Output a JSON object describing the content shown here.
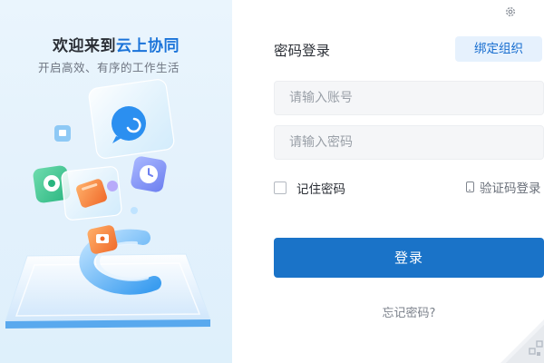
{
  "left": {
    "welcome_prefix": "欢迎来到",
    "brand": "云上协同",
    "subtitle": "开启高效、有序的工作生活"
  },
  "login": {
    "title": "密码登录",
    "bind_org": "绑定组织",
    "account_placeholder": "请输入账号",
    "password_placeholder": "请输入密码",
    "remember_label": "记住密码",
    "remember_checked": false,
    "sms_login_label": "验证码登录",
    "submit_label": "登录",
    "forgot_label": "忘记密码?"
  },
  "icons": {
    "settings": "gear-icon",
    "phone": "phone-icon",
    "corner": "qr-code-corner-icon"
  },
  "colors": {
    "brand_blue": "#1a73d9",
    "primary_button": "#1a73c8",
    "bind_button_bg": "#e6f1fd",
    "input_bg": "#f5f6f8",
    "left_panel_bg": "#e3f1fc"
  }
}
